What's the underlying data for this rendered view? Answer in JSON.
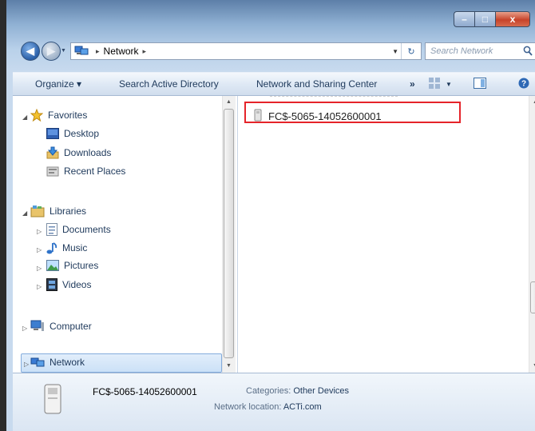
{
  "window": {
    "controls": {
      "minimize": "–",
      "maximize": "□",
      "close": "x"
    }
  },
  "navigation": {
    "back_glyph": "◀",
    "forward_glyph": "▶",
    "address_path": "Network",
    "address_separator": "▸",
    "search_placeholder": "Search Network"
  },
  "toolbar": {
    "organize": "Organize ▾",
    "search_active_directory": "Search Active Directory",
    "network_and_sharing_center": "Network and Sharing Center",
    "more": "»"
  },
  "sidebar": {
    "favorites": {
      "label": "Favorites",
      "items": [
        "Desktop",
        "Downloads",
        "Recent Places"
      ]
    },
    "libraries": {
      "label": "Libraries",
      "items": [
        "Documents",
        "Music",
        "Pictures",
        "Videos"
      ]
    },
    "computer": "Computer",
    "network": "Network"
  },
  "content": {
    "items": [
      {
        "name": "FC$-5065-14052600001",
        "icon": "network-device-icon",
        "highlighted": true
      }
    ]
  },
  "details": {
    "device_name": "FC$-5065-14052600001",
    "categories_label": "Categories:",
    "categories_value": "Other Devices",
    "location_label": "Network location:",
    "location_value": "ACTi.com"
  },
  "colors": {
    "highlight_border": "#e5242a",
    "selection_fill": "#cbe1f7",
    "toolbar_text": "#1e395b"
  }
}
